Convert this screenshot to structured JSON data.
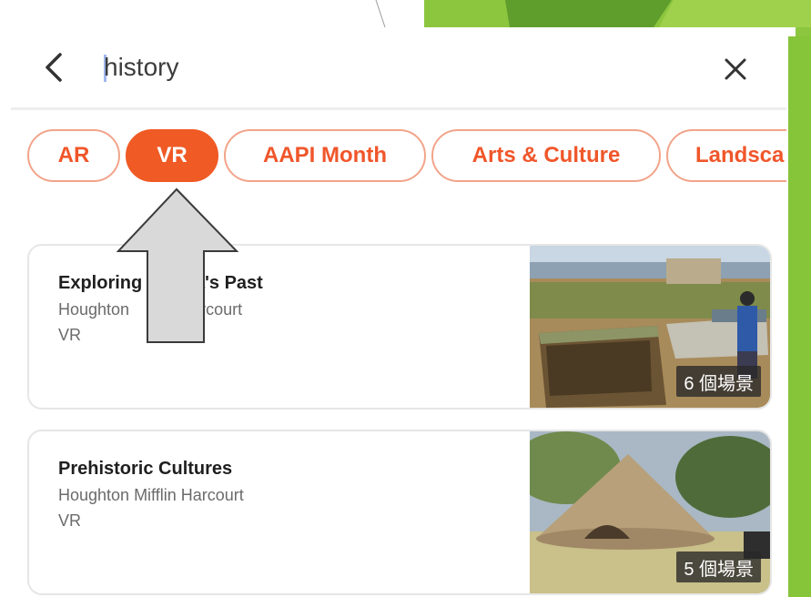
{
  "search": {
    "query": "history"
  },
  "chips": [
    "AR",
    "VR",
    "AAPI Month",
    "Arts & Culture",
    "Landsca"
  ],
  "active_chip": "VR",
  "results": [
    {
      "title": "Exploring America's Past",
      "title_visible": "Exploring      rica's Past",
      "publisher": "Houghton Mifflin Harcourt",
      "publisher_visible": "Houghton        n Harcourt",
      "type": "VR",
      "scenes": "6 個場景"
    },
    {
      "title": "Prehistoric Cultures",
      "publisher": "Houghton Mifflin Harcourt",
      "type": "VR",
      "scenes": "5 個場景"
    }
  ],
  "colors": {
    "accent": "#f05a25",
    "chip_border": "#f2a48a",
    "slide_green": "#7cbf2e"
  },
  "icons": {
    "back": "chevron-left-icon",
    "clear": "close-icon",
    "annotation": "up-arrow-icon"
  }
}
